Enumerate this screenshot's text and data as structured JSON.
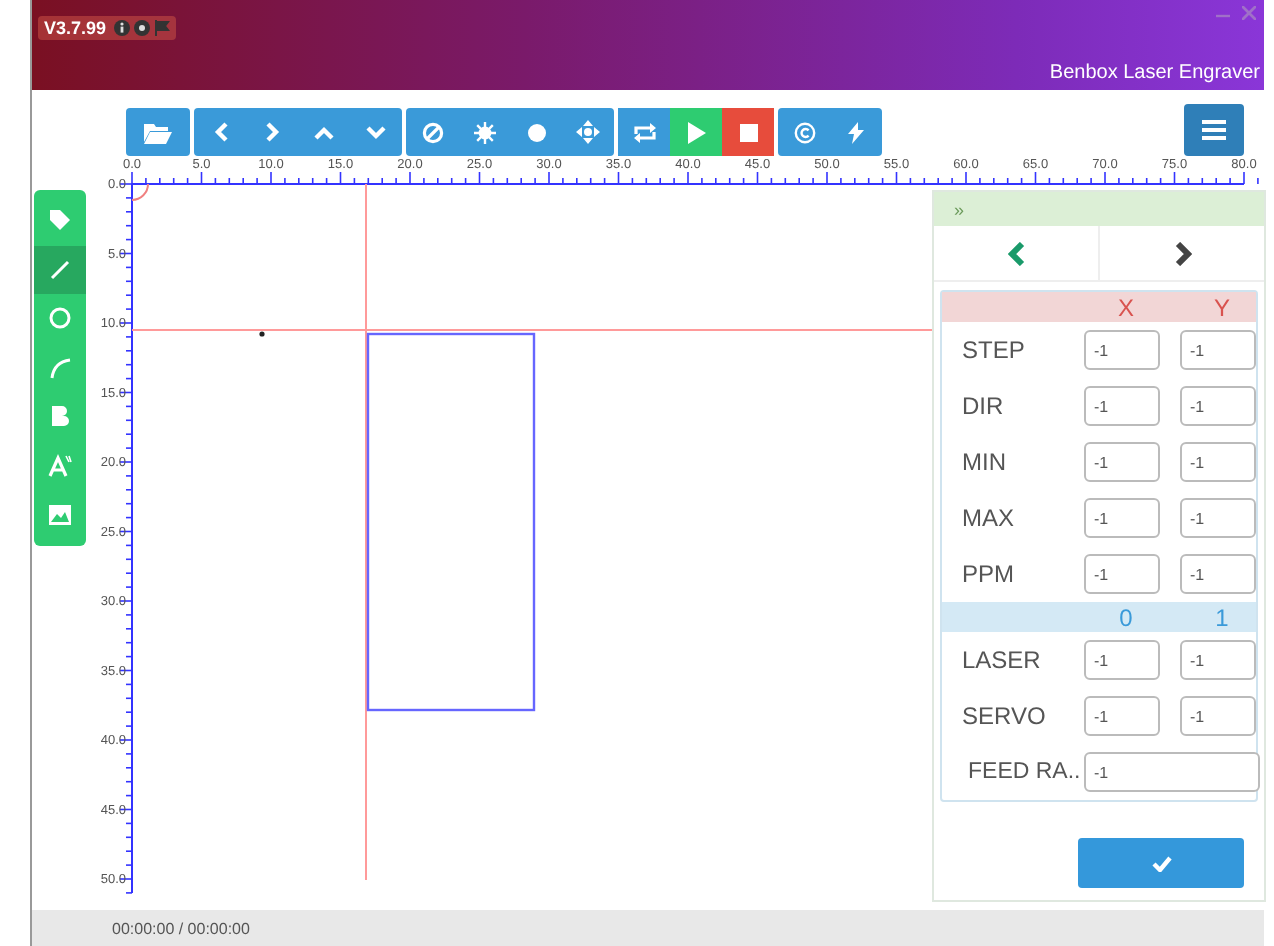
{
  "window": {
    "version": "V3.7.99",
    "title": "Benbox Laser Engraver"
  },
  "ruler": {
    "x_labels": [
      "0.0",
      "5.0",
      "10.0",
      "15.0",
      "20.0",
      "25.0",
      "30.0",
      "35.0",
      "40.0",
      "45.0",
      "50.0",
      "55.0",
      "60.0",
      "65.0",
      "70.0",
      "75.0",
      "80.0"
    ],
    "y_labels": [
      "0.0",
      "5.0",
      "10.0",
      "15.0",
      "20.0",
      "25.0",
      "30.0",
      "35.0",
      "40.0",
      "45.0",
      "50.0"
    ]
  },
  "tools": [
    {
      "selected": false
    },
    {
      "selected": true
    },
    {
      "selected": false
    },
    {
      "selected": false
    },
    {
      "selected": false
    },
    {
      "selected": false
    },
    {
      "selected": false
    }
  ],
  "panel": {
    "header": "»",
    "tabs": [
      {
        "selected": true
      },
      {
        "selected": false
      }
    ],
    "axis_columns": [
      "X",
      "Y"
    ],
    "axis_rows": [
      {
        "label": "STEP",
        "values": [
          "-1",
          "-1"
        ]
      },
      {
        "label": "DIR",
        "values": [
          "-1",
          "-1"
        ]
      },
      {
        "label": "MIN",
        "values": [
          "-1",
          "-1"
        ]
      },
      {
        "label": "MAX",
        "values": [
          "-1",
          "-1"
        ]
      },
      {
        "label": "PPM",
        "values": [
          "-1",
          "-1"
        ]
      }
    ],
    "output_columns": [
      "0",
      "1"
    ],
    "output_rows": [
      {
        "label": "LASER",
        "values": [
          "-1",
          "-1"
        ]
      },
      {
        "label": "SERVO",
        "values": [
          "-1",
          "-1"
        ]
      },
      {
        "label": "FEED RA..",
        "values": [
          "-1"
        ]
      }
    ]
  },
  "status_bar": {
    "time": "00:00:00 / 00:00:00"
  }
}
